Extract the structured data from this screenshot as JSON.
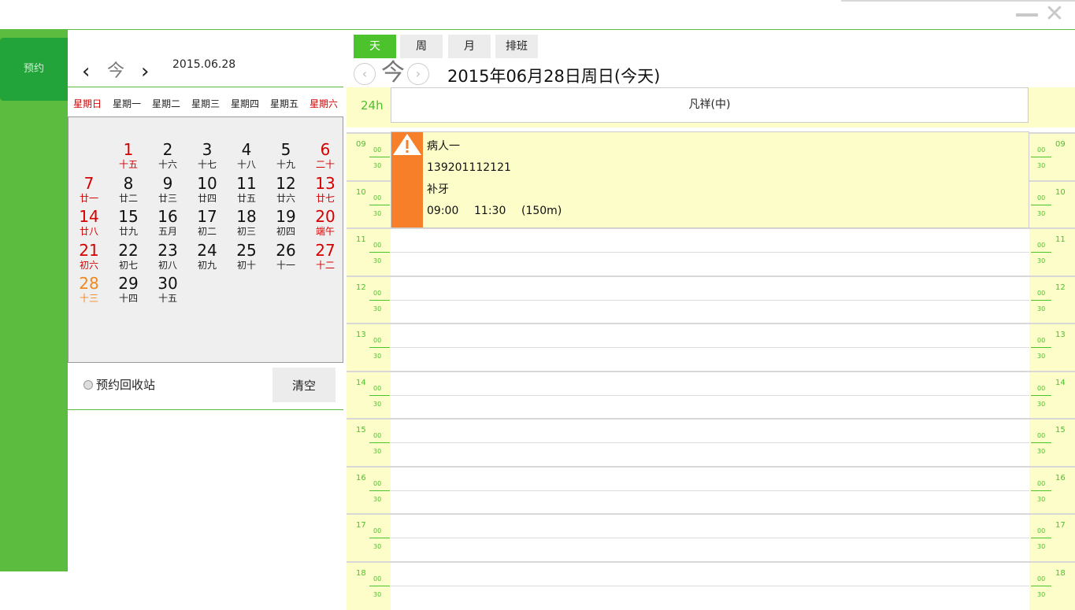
{
  "window": {
    "minimize_label": "minimize",
    "close_glyph": "✕"
  },
  "leftnav": {
    "items": [
      {
        "label": "预约"
      }
    ]
  },
  "minical": {
    "prev_glyph": "‹",
    "today_label": "今",
    "next_glyph": "›",
    "date": "2015.06.28",
    "weekdays": [
      "星期日",
      "星期一",
      "星期二",
      "星期三",
      "星期四",
      "星期五",
      "星期六"
    ],
    "days": [
      {
        "d": "1",
        "l": "十五",
        "red": true
      },
      {
        "d": "2",
        "l": "十六"
      },
      {
        "d": "3",
        "l": "十七"
      },
      {
        "d": "4",
        "l": "十八"
      },
      {
        "d": "5",
        "l": "十九"
      },
      {
        "d": "6",
        "l": "二十",
        "red": true
      },
      {
        "d": "7",
        "l": "廿一",
        "red": true
      },
      {
        "d": "8",
        "l": "廿二"
      },
      {
        "d": "9",
        "l": "廿三"
      },
      {
        "d": "10",
        "l": "廿四"
      },
      {
        "d": "11",
        "l": "廿五"
      },
      {
        "d": "12",
        "l": "廿六"
      },
      {
        "d": "13",
        "l": "廿七",
        "red": true
      },
      {
        "d": "14",
        "l": "廿八",
        "red": true
      },
      {
        "d": "15",
        "l": "廿九"
      },
      {
        "d": "16",
        "l": "五月"
      },
      {
        "d": "17",
        "l": "初二"
      },
      {
        "d": "18",
        "l": "初三"
      },
      {
        "d": "19",
        "l": "初四"
      },
      {
        "d": "20",
        "l": "端午",
        "red": true
      },
      {
        "d": "21",
        "l": "初六",
        "red": true
      },
      {
        "d": "22",
        "l": "初七"
      },
      {
        "d": "23",
        "l": "初八"
      },
      {
        "d": "24",
        "l": "初九"
      },
      {
        "d": "25",
        "l": "初十"
      },
      {
        "d": "26",
        "l": "十一"
      },
      {
        "d": "27",
        "l": "十二",
        "red": true
      },
      {
        "d": "28",
        "l": "十三",
        "today": true
      },
      {
        "d": "29",
        "l": "十四"
      },
      {
        "d": "30",
        "l": "十五"
      }
    ],
    "recycle_label": "预约回收站",
    "clear_label": "清空"
  },
  "schedule": {
    "tabs": [
      {
        "label": "天",
        "active": true
      },
      {
        "label": "周"
      },
      {
        "label": "月"
      },
      {
        "label": "排班"
      }
    ],
    "prev_glyph": "‹",
    "today_label": "今",
    "next_glyph": "›",
    "date_title": "2015年06月28日周日(今天)",
    "allday_label": "24h",
    "doctor": "凡祥(中)",
    "hours": [
      "09",
      "10",
      "11",
      "12",
      "13",
      "14",
      "15",
      "16",
      "17",
      "18"
    ],
    "sub_labels": [
      "00",
      "30"
    ],
    "appointment": {
      "patient": "病人一",
      "phone": "139201112121",
      "treatment": "补牙",
      "start": "09:00",
      "end": "11:30",
      "duration": "(150m)",
      "color": "#f77f2a"
    }
  },
  "colors": {
    "green": "#5cbc3f",
    "dark_green": "#23a43a",
    "accent_green": "#4cc22d",
    "slot_bg": "#fcfdc9",
    "red": "#d40000",
    "today": "#f0871e"
  }
}
